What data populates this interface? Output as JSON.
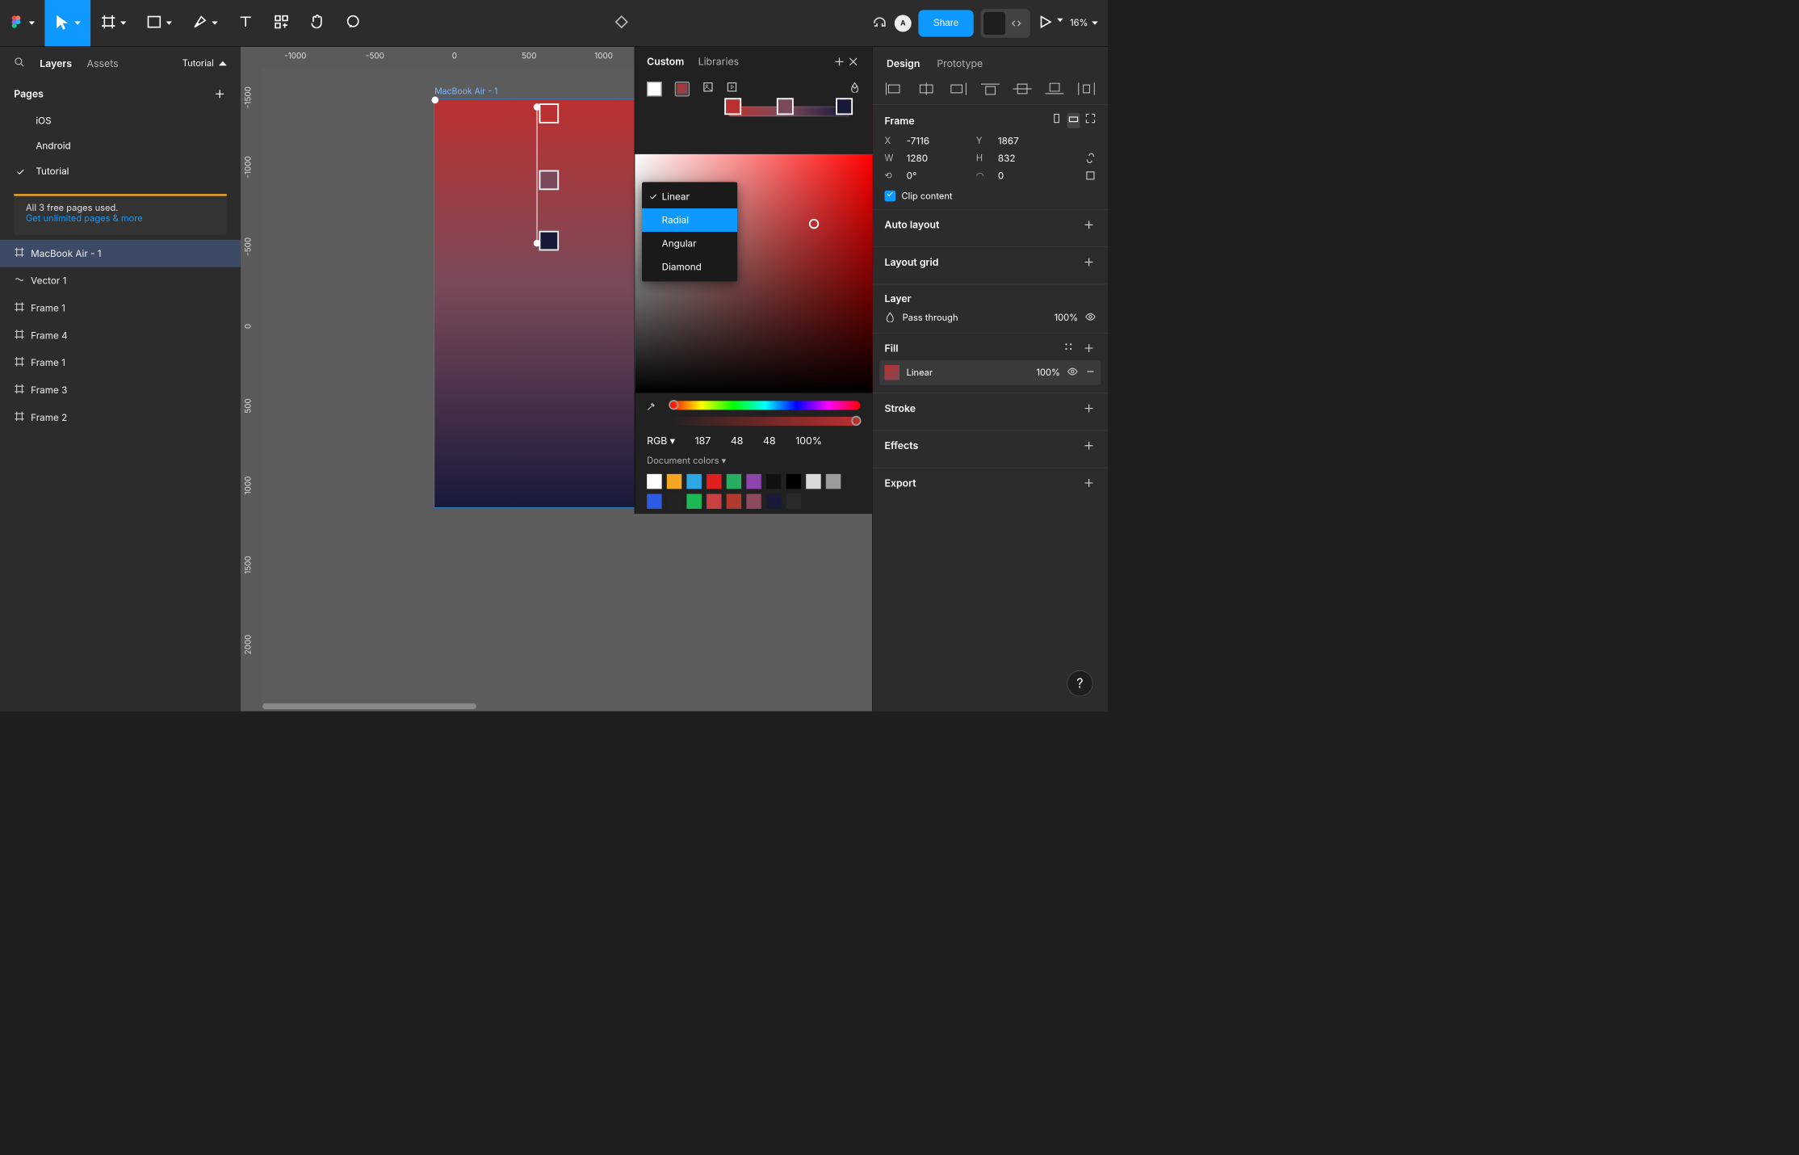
{
  "topbar": {
    "share": "Share",
    "avatar": "A",
    "zoom": "16%"
  },
  "left": {
    "tabs": {
      "layers": "Layers",
      "assets": "Assets",
      "tutorial": "Tutorial"
    },
    "pages_hd": "Pages",
    "pages": [
      "iOS",
      "Android",
      "Tutorial"
    ],
    "active_page_idx": 2,
    "warn_line1": "All 3 free pages used.",
    "warn_line2": "Get unlimited pages & more",
    "layers": [
      "MacBook Air - 1",
      "Vector 1",
      "Frame 1",
      "Frame 4",
      "Frame 1",
      "Frame 3",
      "Frame 2"
    ],
    "selected_layer_idx": 0
  },
  "ruler_h": [
    "-1000",
    "-500",
    "0",
    "500",
    "1000"
  ],
  "ruler_v": [
    "-1500",
    "-1000",
    "-500",
    "0",
    "500",
    "1000",
    "1500",
    "2000"
  ],
  "frame_label": "MacBook Air - 1",
  "color_panel": {
    "tab_custom": "Custom",
    "tab_libraries": "Libraries",
    "types": [
      "Linear",
      "Radial",
      "Angular",
      "Diamond"
    ],
    "type_selected_idx": 0,
    "type_highlighted_idx": 1,
    "mode": "RGB",
    "r": "187",
    "g": "48",
    "b": "48",
    "a": "100%",
    "doc_colors_hd": "Document colors",
    "swatches": [
      "#ffffff",
      "#f5a623",
      "#2aa7e4",
      "#e02020",
      "#27ae60",
      "#8e44ad",
      "#111111",
      "#000000",
      "#d9d9d9",
      "#9b9b9b",
      "#2d5be3",
      "#222222",
      "#1db954",
      "#c94040",
      "#b03a2e",
      "#8e4a5c",
      "#19193a",
      "#2a2a2a"
    ]
  },
  "right": {
    "tab_design": "Design",
    "tab_proto": "Prototype",
    "frame_hd": "Frame",
    "x": "-7116",
    "y": "1867",
    "w": "1280",
    "h": "832",
    "rot": "0°",
    "radius": "0",
    "clip": "Clip content",
    "auto_layout": "Auto layout",
    "layout_grid": "Layout grid",
    "layer_hd": "Layer",
    "blend": "Pass through",
    "layer_opacity": "100%",
    "fill_hd": "Fill",
    "fill_type": "Linear",
    "fill_opacity": "100%",
    "stroke_hd": "Stroke",
    "effects_hd": "Effects",
    "export_hd": "Export"
  }
}
